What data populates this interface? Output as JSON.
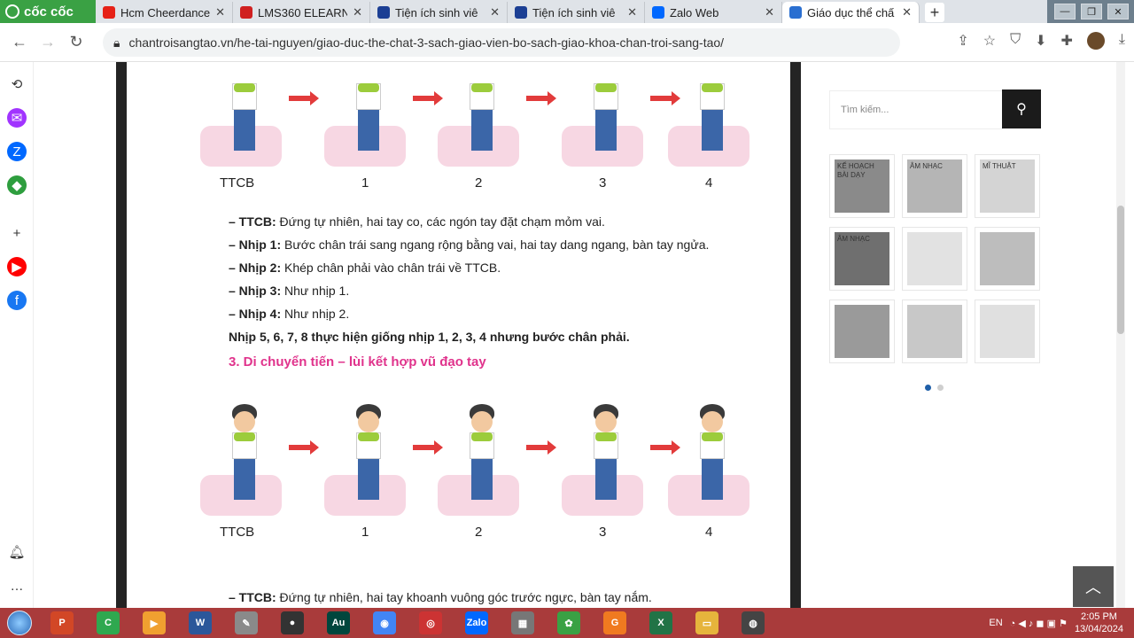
{
  "browser": {
    "brand": "cốc cốc",
    "tabs": [
      {
        "title": "Hcm Cheerdance",
        "favicon_color": "#e62117"
      },
      {
        "title": "LMS360 ELEARN",
        "favicon_color": "#d02020"
      },
      {
        "title": "Tiện ích sinh viê",
        "favicon_color": "#1c3f94"
      },
      {
        "title": "Tiện ích sinh viê",
        "favicon_color": "#1c3f94"
      },
      {
        "title": "Zalo Web",
        "favicon_color": "#0068ff"
      },
      {
        "title": "Giáo dục thể chấ",
        "favicon_color": "#2a6fd1",
        "active": true
      }
    ],
    "new_tab": "+",
    "url": "chantroisangtao.vn/he-tai-nguyen/giao-duc-the-chat-3-sach-giao-vien-bo-sach-giao-khoa-chan-troi-sang-tao/"
  },
  "left_sidebar": [
    {
      "icon": "history-icon",
      "color": "#333333"
    },
    {
      "icon": "messenger-icon",
      "color": "#a134ff"
    },
    {
      "icon": "zalo-icon",
      "color": "#0068ff"
    },
    {
      "icon": "gamepad-icon",
      "color": "#2e9e3e"
    },
    {
      "icon": "plus-icon",
      "color": "#333333"
    },
    {
      "icon": "youtube-icon",
      "color": "#ff0000"
    },
    {
      "icon": "facebook-icon",
      "color": "#1877f2"
    },
    {
      "icon": "bell-icon",
      "color": "#333333"
    },
    {
      "icon": "more-icon",
      "color": "#333333"
    }
  ],
  "content": {
    "figure1_labels": [
      "TTCB",
      "1",
      "2",
      "3",
      "4"
    ],
    "lines": [
      {
        "bold": "– TTCB:",
        "text": " Đứng tự nhiên, hai tay co, các ngón tay đặt chạm mỏm vai."
      },
      {
        "bold": "– Nhịp 1:",
        "text": " Bước chân trái sang ngang rộng bằng vai, hai tay dang ngang, bàn tay ngửa."
      },
      {
        "bold": "– Nhịp 2:",
        "text": " Khép chân phải vào chân trái về TTCB."
      },
      {
        "bold": "– Nhịp 3:",
        "text": " Như nhịp 1."
      },
      {
        "bold": "– Nhịp 4:",
        "text": " Như nhịp 2."
      }
    ],
    "summary": "Nhịp 5, 6, 7, 8 thực hiện giống nhịp 1, 2, 3, 4 nhưng bước chân phải.",
    "section_title": "3. Di chuyển tiến – lùi kết hợp vũ đạo tay",
    "figure2_labels": [
      "TTCB",
      "1",
      "2",
      "3",
      "4"
    ],
    "bottom_line": {
      "bold": "– TTCB:",
      "text": " Đứng tự nhiên, hai tay khoanh vuông góc trước ngực, bàn tay nắm."
    }
  },
  "sidebar": {
    "search_placeholder": "Tìm kiếm...",
    "thumbnails": [
      {
        "title": "KẾ HOẠCH BÀI DẠY",
        "color": "#8a8a8a"
      },
      {
        "title": "ÂM NHẠC",
        "color": "#b5b5b5"
      },
      {
        "title": "MĨ THUẬT",
        "color": "#d4d4d4"
      },
      {
        "title": "ÂM NHẠC",
        "color": "#6f6f6f"
      },
      {
        "title": "",
        "color": "#e2e2e2"
      },
      {
        "title": "",
        "color": "#bdbdbd"
      },
      {
        "title": "",
        "color": "#9a9a9a"
      },
      {
        "title": "",
        "color": "#c8c8c8"
      },
      {
        "title": "",
        "color": "#e0e0e0"
      }
    ],
    "dots": [
      {
        "active": true
      },
      {
        "active": false
      }
    ]
  },
  "taskbar": {
    "apps": [
      {
        "icon": "powerpoint-icon",
        "color": "#d24726",
        "label": "P"
      },
      {
        "icon": "camtasia-icon",
        "color": "#2fa84f",
        "label": "C"
      },
      {
        "icon": "media-icon",
        "color": "#f0a030",
        "label": "▶"
      },
      {
        "icon": "word-icon",
        "color": "#2b579a",
        "label": "W"
      },
      {
        "icon": "paint-icon",
        "color": "#8a8a8a",
        "label": "✎"
      },
      {
        "icon": "obs-icon",
        "color": "#333333",
        "label": "●"
      },
      {
        "icon": "audition-icon",
        "color": "#00463d",
        "label": "Au"
      },
      {
        "icon": "chrome-icon",
        "color": "#4285f4",
        "label": "◉"
      },
      {
        "icon": "app-icon",
        "color": "#cc3333",
        "label": "◎"
      },
      {
        "icon": "zalo-icon",
        "color": "#0068ff",
        "label": "Zalo"
      },
      {
        "icon": "calculator-icon",
        "color": "#777777",
        "label": "▦"
      },
      {
        "icon": "coccoc-icon",
        "color": "#3aa144",
        "label": "✿"
      },
      {
        "icon": "g-icon",
        "color": "#f07a20",
        "label": "G"
      },
      {
        "icon": "excel-icon",
        "color": "#217346",
        "label": "X"
      },
      {
        "icon": "folder-icon",
        "color": "#e6b43c",
        "label": "▭"
      },
      {
        "icon": "film-icon",
        "color": "#444444",
        "label": "◍"
      }
    ],
    "lang": "EN",
    "time": "2:05 PM",
    "date": "13/04/2024"
  }
}
